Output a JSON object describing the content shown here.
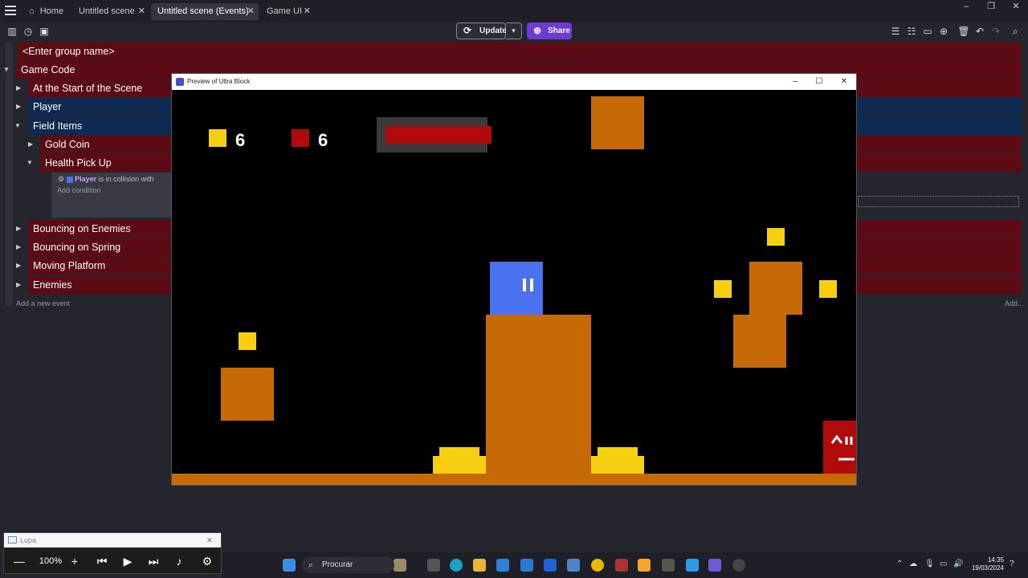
{
  "tabs": [
    {
      "label": "Home"
    },
    {
      "label": "Untitled scene"
    },
    {
      "label": "Untitled scene (Events)"
    },
    {
      "label": "Game UI"
    }
  ],
  "toolbar": {
    "update_label": "Update",
    "share_label": "Share"
  },
  "events": {
    "group_placeholder": "<Enter group name>",
    "game_code": "Game Code",
    "start_scene": "At the Start of the Scene",
    "player": "Player",
    "field_items": "Field Items",
    "gold_coin": "Gold Coin",
    "health_pickup": "Health Pick Up",
    "condition_object": "Player",
    "condition_text": "is in collision with",
    "add_condition": "Add condition",
    "bouncing_enemies": "Bouncing on Enemies",
    "bouncing_spring": "Bouncing on Spring",
    "moving_platform": "Moving Platform",
    "enemies": "Enemies",
    "add_event": "Add a new event",
    "add_right": "Add..."
  },
  "preview": {
    "title": "Preview of Ultra Block",
    "coins": "6",
    "health": "6",
    "health_bar_fill": 1.0
  },
  "magnifier": {
    "title": "Lupa",
    "zoom": "100%"
  },
  "taskbar": {
    "search": "Procurar",
    "time": "14:35",
    "date": "19/03/2024"
  },
  "colors": {
    "event_red": "#5c0a14",
    "event_blue": "#0d2a52",
    "share": "#6d3ad4",
    "orange": "#c66a08",
    "yellow": "#f5cf10",
    "player": "#4a72f0"
  }
}
